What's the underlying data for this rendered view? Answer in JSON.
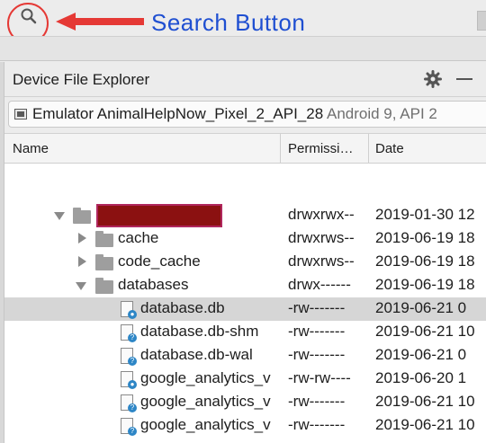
{
  "annotation": {
    "label": "Search Button",
    "color": "#1f4fd1"
  },
  "panel": {
    "title": "Device File Explorer",
    "device": {
      "name": "Emulator AnimalHelpNow_Pixel_2_API_28",
      "extra": "Android 9, API 2"
    }
  },
  "columns": {
    "name": "Name",
    "permissions": "Permissi…",
    "date": "Date"
  },
  "rows": [
    {
      "name": "",
      "perm": "drwxrwx--",
      "date": "2019-01-30 12",
      "type": "folder",
      "expanded": true,
      "redacted": true
    },
    {
      "name": "cache",
      "perm": "drwxrws--",
      "date": "2019-06-19 18",
      "type": "folder",
      "expanded": false
    },
    {
      "name": "code_cache",
      "perm": "drwxrws--",
      "date": "2019-06-19 18",
      "type": "folder",
      "expanded": false
    },
    {
      "name": "databases",
      "perm": "drwx------",
      "date": "2019-06-19 18",
      "type": "folder",
      "expanded": true
    },
    {
      "name": "database.db",
      "perm": "-rw-------",
      "date": "2019-06-21 0",
      "type": "file",
      "selected": true
    },
    {
      "name": "database.db-shm",
      "perm": "-rw-------",
      "date": "2019-06-21 10",
      "type": "file"
    },
    {
      "name": "database.db-wal",
      "perm": "-rw-------",
      "date": "2019-06-21 0",
      "type": "file"
    },
    {
      "name": "google_analytics_v",
      "perm": "-rw-rw----",
      "date": "2019-06-20 1",
      "type": "file"
    },
    {
      "name": "google_analytics_v",
      "perm": "-rw-------",
      "date": "2019-06-21 10",
      "type": "file"
    },
    {
      "name": "google_analytics_v",
      "perm": "-rw-------",
      "date": "2019-06-21 10",
      "type": "file"
    }
  ]
}
